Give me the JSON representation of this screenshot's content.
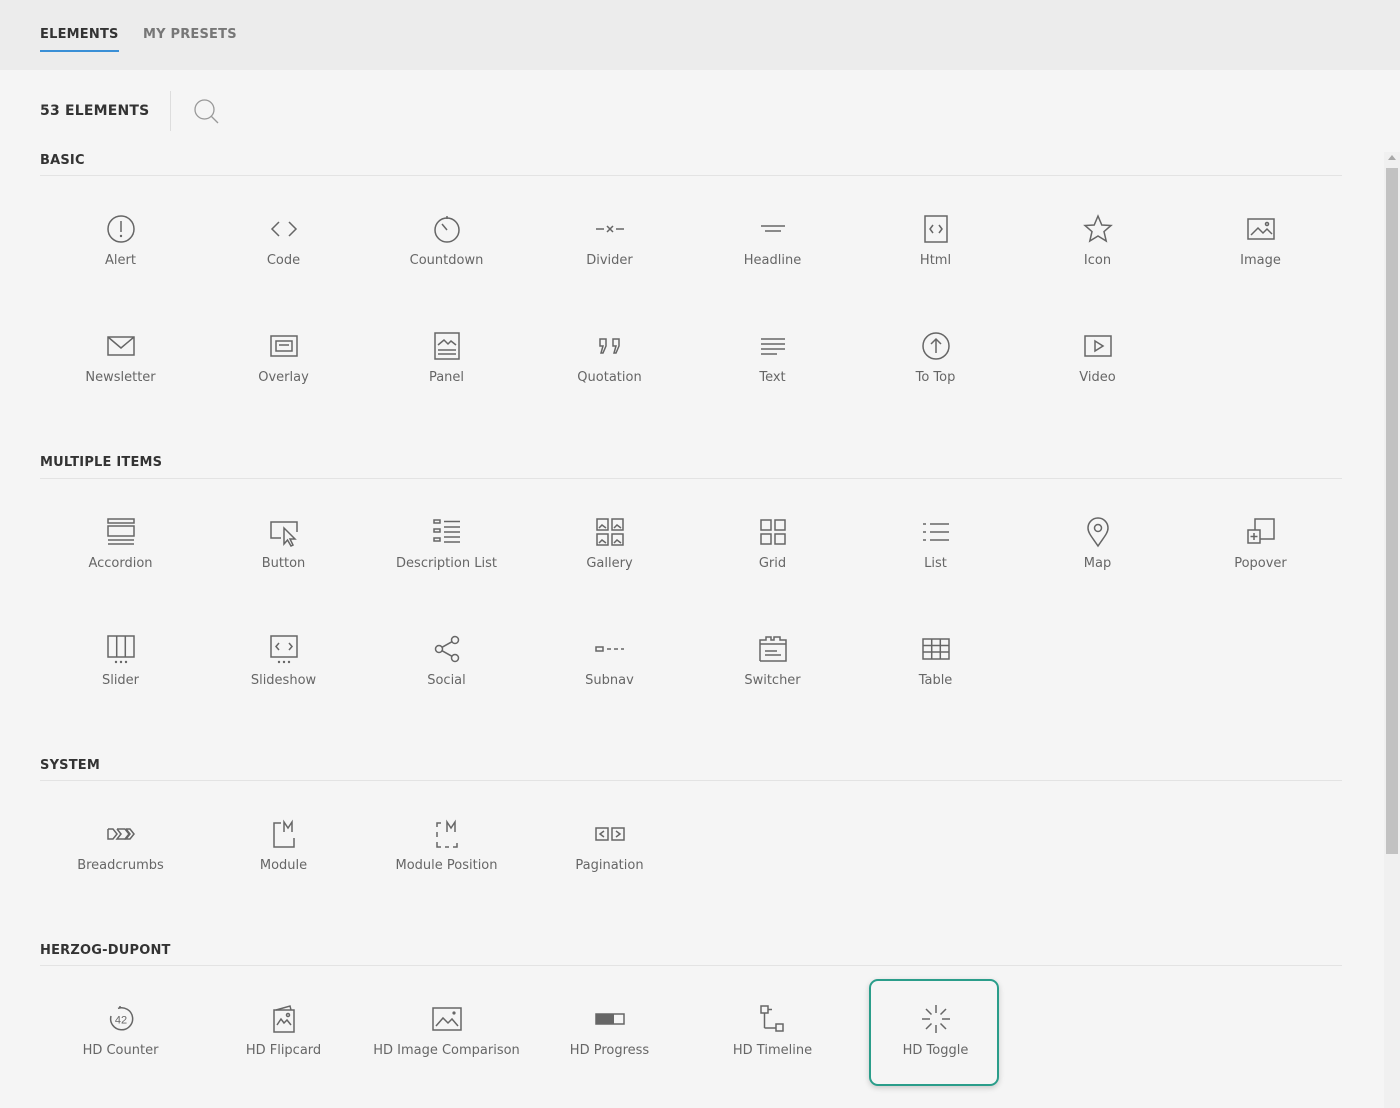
{
  "tabs": [
    {
      "label": "ELEMENTS",
      "active": true
    },
    {
      "label": "MY PRESETS",
      "active": false
    }
  ],
  "toolbar": {
    "count": "53 ELEMENTS",
    "search_icon": "search-icon"
  },
  "sections": [
    {
      "title": "BASIC",
      "items": [
        {
          "label": "Alert",
          "icon": "alert-icon"
        },
        {
          "label": "Code",
          "icon": "code-icon"
        },
        {
          "label": "Countdown",
          "icon": "countdown-icon"
        },
        {
          "label": "Divider",
          "icon": "divider-icon"
        },
        {
          "label": "Headline",
          "icon": "headline-icon"
        },
        {
          "label": "Html",
          "icon": "html-icon"
        },
        {
          "label": "Icon",
          "icon": "star-icon"
        },
        {
          "label": "Image",
          "icon": "image-icon"
        },
        {
          "label": "Newsletter",
          "icon": "envelope-icon"
        },
        {
          "label": "Overlay",
          "icon": "overlay-icon"
        },
        {
          "label": "Panel",
          "icon": "panel-icon"
        },
        {
          "label": "Quotation",
          "icon": "quotation-icon"
        },
        {
          "label": "Text",
          "icon": "text-icon"
        },
        {
          "label": "To Top",
          "icon": "arrow-up-circle-icon"
        },
        {
          "label": "Video",
          "icon": "video-icon"
        }
      ]
    },
    {
      "title": "MULTIPLE ITEMS",
      "items": [
        {
          "label": "Accordion",
          "icon": "accordion-icon"
        },
        {
          "label": "Button",
          "icon": "button-icon"
        },
        {
          "label": "Description List",
          "icon": "description-list-icon"
        },
        {
          "label": "Gallery",
          "icon": "gallery-icon"
        },
        {
          "label": "Grid",
          "icon": "grid-icon"
        },
        {
          "label": "List",
          "icon": "list-icon"
        },
        {
          "label": "Map",
          "icon": "map-pin-icon"
        },
        {
          "label": "Popover",
          "icon": "popover-icon"
        },
        {
          "label": "Slider",
          "icon": "slider-icon"
        },
        {
          "label": "Slideshow",
          "icon": "slideshow-icon"
        },
        {
          "label": "Social",
          "icon": "share-icon"
        },
        {
          "label": "Subnav",
          "icon": "subnav-icon"
        },
        {
          "label": "Switcher",
          "icon": "switcher-icon"
        },
        {
          "label": "Table",
          "icon": "table-icon"
        }
      ]
    },
    {
      "title": "SYSTEM",
      "items": [
        {
          "label": "Breadcrumbs",
          "icon": "breadcrumbs-icon"
        },
        {
          "label": "Module",
          "icon": "module-icon"
        },
        {
          "label": "Module Position",
          "icon": "module-position-icon"
        },
        {
          "label": "Pagination",
          "icon": "pagination-icon"
        }
      ]
    },
    {
      "title": "HERZOG-DUPONT",
      "items": [
        {
          "label": "HD Counter",
          "icon": "counter-icon",
          "badge": "42"
        },
        {
          "label": "HD Flipcard",
          "icon": "flipcard-icon"
        },
        {
          "label": "HD Image Comparison",
          "icon": "image-comparison-icon"
        },
        {
          "label": "HD Progress",
          "icon": "progress-icon"
        },
        {
          "label": "HD Timeline",
          "icon": "timeline-icon"
        },
        {
          "label": "HD Toggle",
          "icon": "toggle-icon",
          "highlighted": true
        }
      ]
    }
  ],
  "colors": {
    "accent": "#3a8fd6",
    "highlight": "#2a9d8a"
  }
}
